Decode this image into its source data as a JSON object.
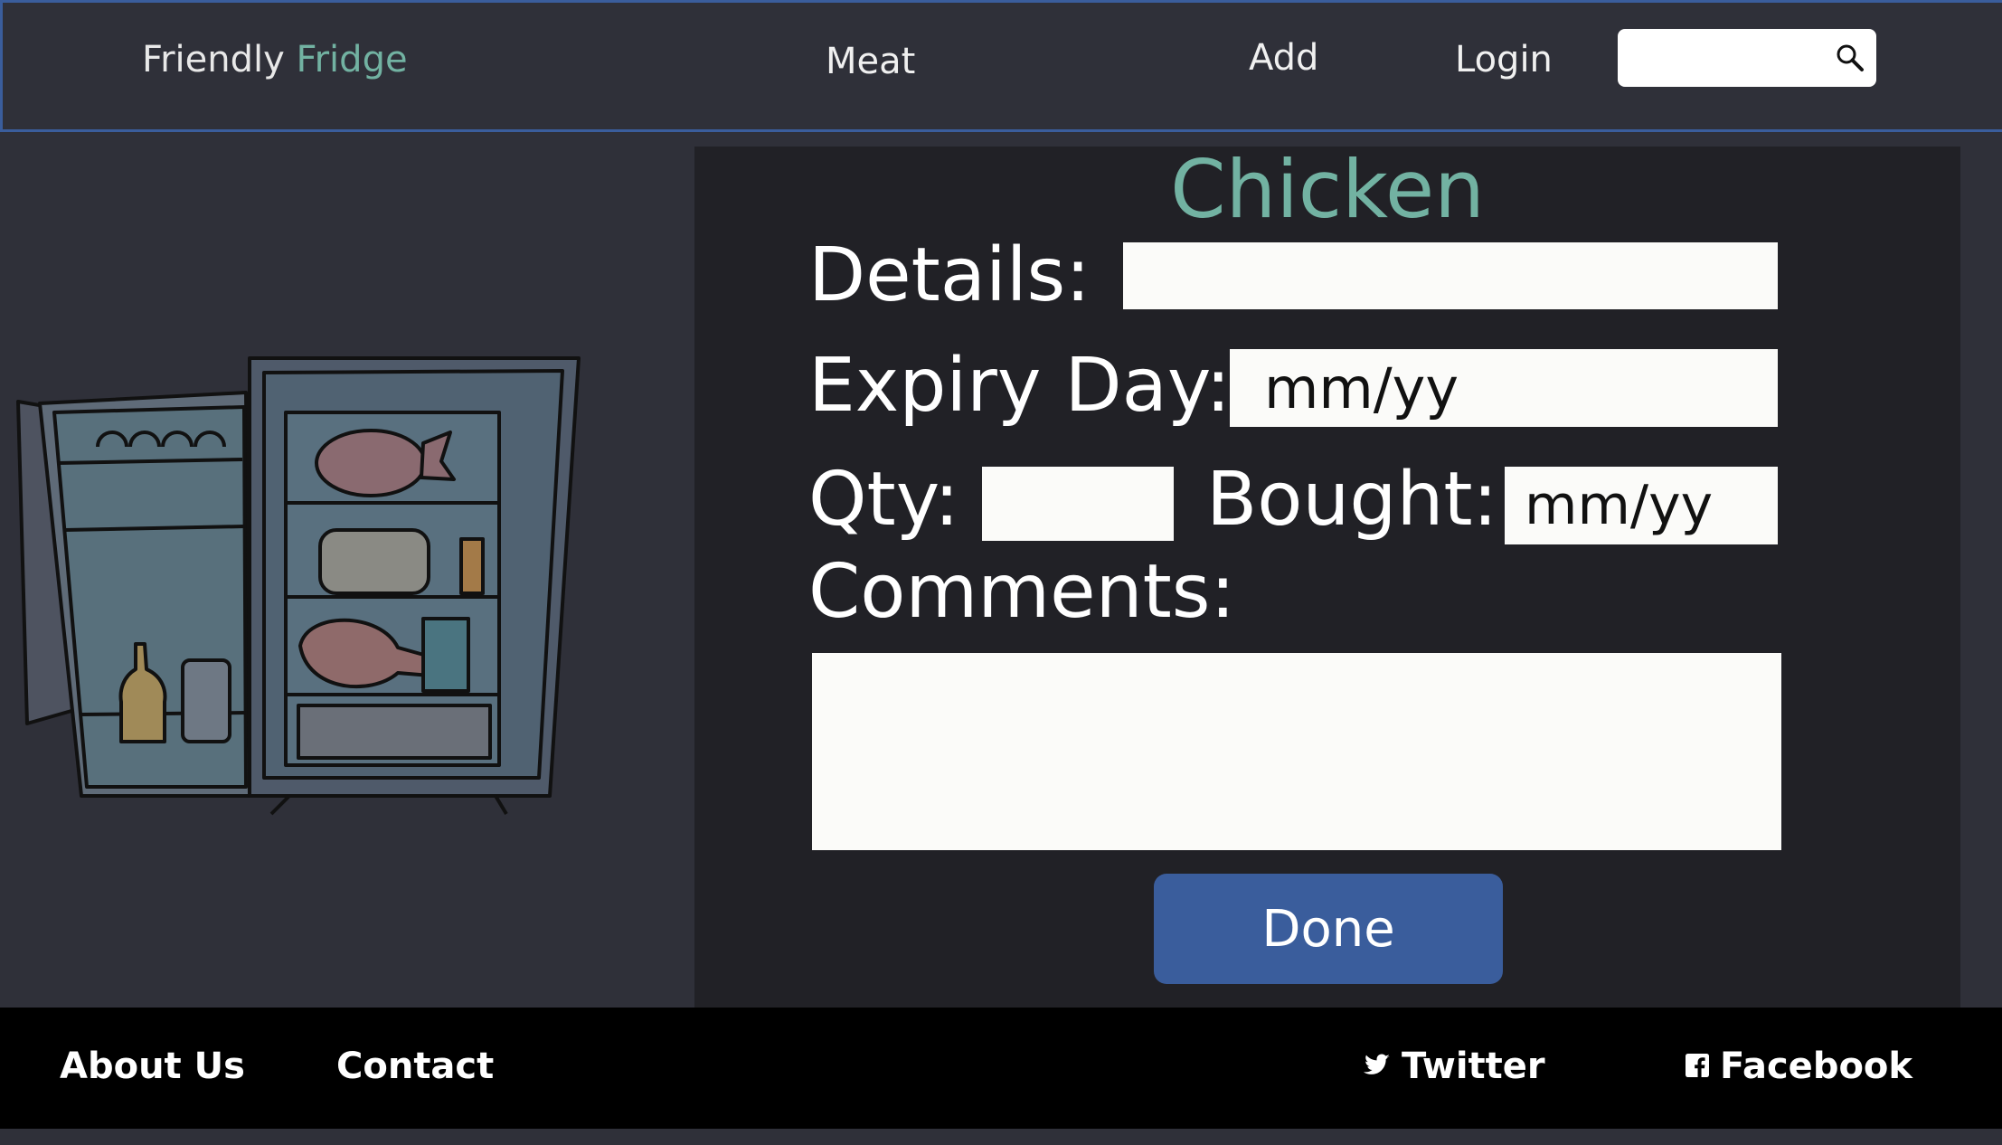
{
  "header": {
    "brand_part1": "Friendly",
    "brand_part2": "Fridge",
    "nav": {
      "meat": "Meat",
      "add": "Add",
      "login": "Login"
    },
    "search": {
      "value": "",
      "placeholder": ""
    }
  },
  "form": {
    "title": "Chicken",
    "details_label": "Details:",
    "details_value": "",
    "expiry_label": "Expiry Day:",
    "expiry_placeholder": "mm/yy",
    "qty_label": "Qty:",
    "qty_value": "",
    "bought_label": "Bought:",
    "bought_placeholder": "mm/yy",
    "comments_label": "Comments:",
    "comments_value": "",
    "done_label": "Done"
  },
  "footer": {
    "about": "About Us",
    "contact": "Contact",
    "twitter": "Twitter",
    "facebook": "Facebook"
  },
  "colors": {
    "accent": "#72b2a2",
    "button": "#3a5d9c",
    "background": "#2f3039",
    "panel": "#212126",
    "footer": "#000000"
  },
  "icons": [
    "search-icon",
    "twitter-icon",
    "facebook-icon",
    "fridge-illustration"
  ]
}
